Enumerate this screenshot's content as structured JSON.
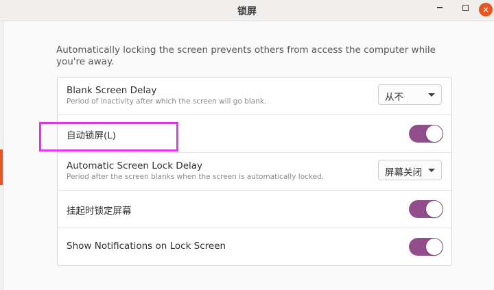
{
  "window": {
    "title": "锁屏",
    "controls": {
      "minimize": "minimize-icon",
      "maximize": "maximize-icon",
      "close": "×"
    }
  },
  "description": "Automatically locking the screen prevents others from access the computer while you're away.",
  "settings": {
    "blank_delay": {
      "label": "Blank Screen Delay",
      "sublabel": "Period of inactivity after which the screen will go blank.",
      "value": "从不"
    },
    "auto_lock": {
      "label": "自动锁屏(L)",
      "enabled": true
    },
    "lock_delay": {
      "label": "Automatic Screen Lock Delay",
      "sublabel": "Period after the screen blanks when the screen is automatically locked.",
      "value": "屏幕关闭"
    },
    "lock_on_suspend": {
      "label": "挂起时锁定屏幕",
      "enabled": true
    },
    "notifications": {
      "label": "Show Notifications on Lock Screen",
      "enabled": true
    }
  },
  "colors": {
    "accent_toggle": "#924d8b",
    "close_button": "#e95420",
    "highlight_box": "#e833e8"
  }
}
